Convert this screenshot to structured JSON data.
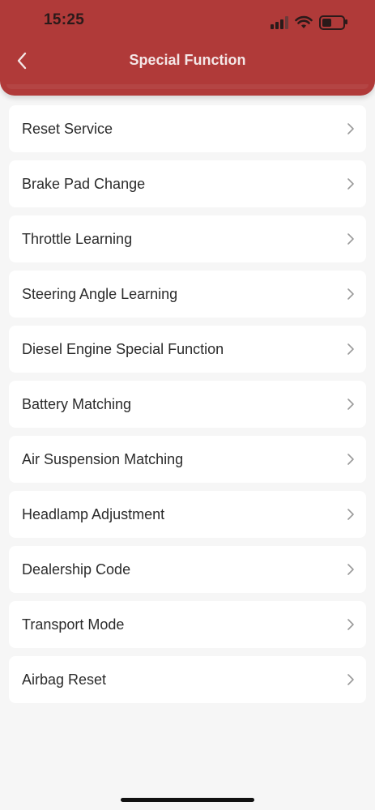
{
  "status_bar": {
    "time": "15:25",
    "battery_level": 0.45
  },
  "nav": {
    "title": "Special Function",
    "back_icon": "chevron-left-icon"
  },
  "colors": {
    "header": "#b03a39",
    "background": "#f6f6f6",
    "card": "#ffffff"
  },
  "items": [
    {
      "label": "Reset Service"
    },
    {
      "label": "Brake Pad Change"
    },
    {
      "label": "Throttle Learning"
    },
    {
      "label": "Steering Angle Learning"
    },
    {
      "label": "Diesel Engine Special Function"
    },
    {
      "label": "Battery Matching"
    },
    {
      "label": "Air Suspension Matching"
    },
    {
      "label": "Headlamp Adjustment"
    },
    {
      "label": "Dealership Code"
    },
    {
      "label": "Transport Mode"
    },
    {
      "label": "Airbag Reset"
    }
  ]
}
